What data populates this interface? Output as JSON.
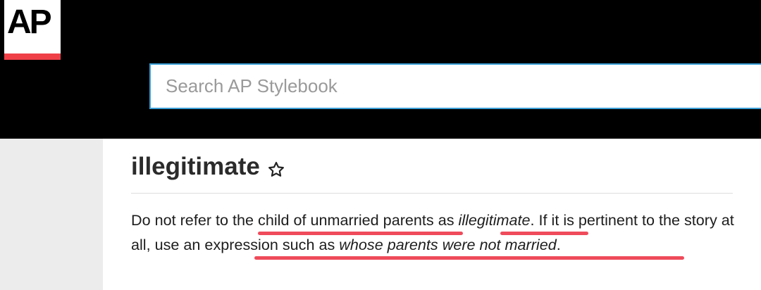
{
  "header": {
    "logo_text": "AP",
    "search": {
      "placeholder": "Search AP Stylebook"
    }
  },
  "entry": {
    "title": "illegitimate",
    "star_icon": "star-outline-icon",
    "body": {
      "s1": "Do not refer to the child of unmarried parents as ",
      "s1_term": "illegitimate",
      "s2": ". If it is pertinent to the story at all, use an expression such as ",
      "s2_term": "whose parents were not married",
      "s3": "."
    }
  },
  "colors": {
    "header_bg": "#000000",
    "logo_accent": "#ef4048",
    "search_border": "#3a9fd6",
    "highlight_underline": "#ef4b5b",
    "sidebar_bg": "#ececec"
  }
}
